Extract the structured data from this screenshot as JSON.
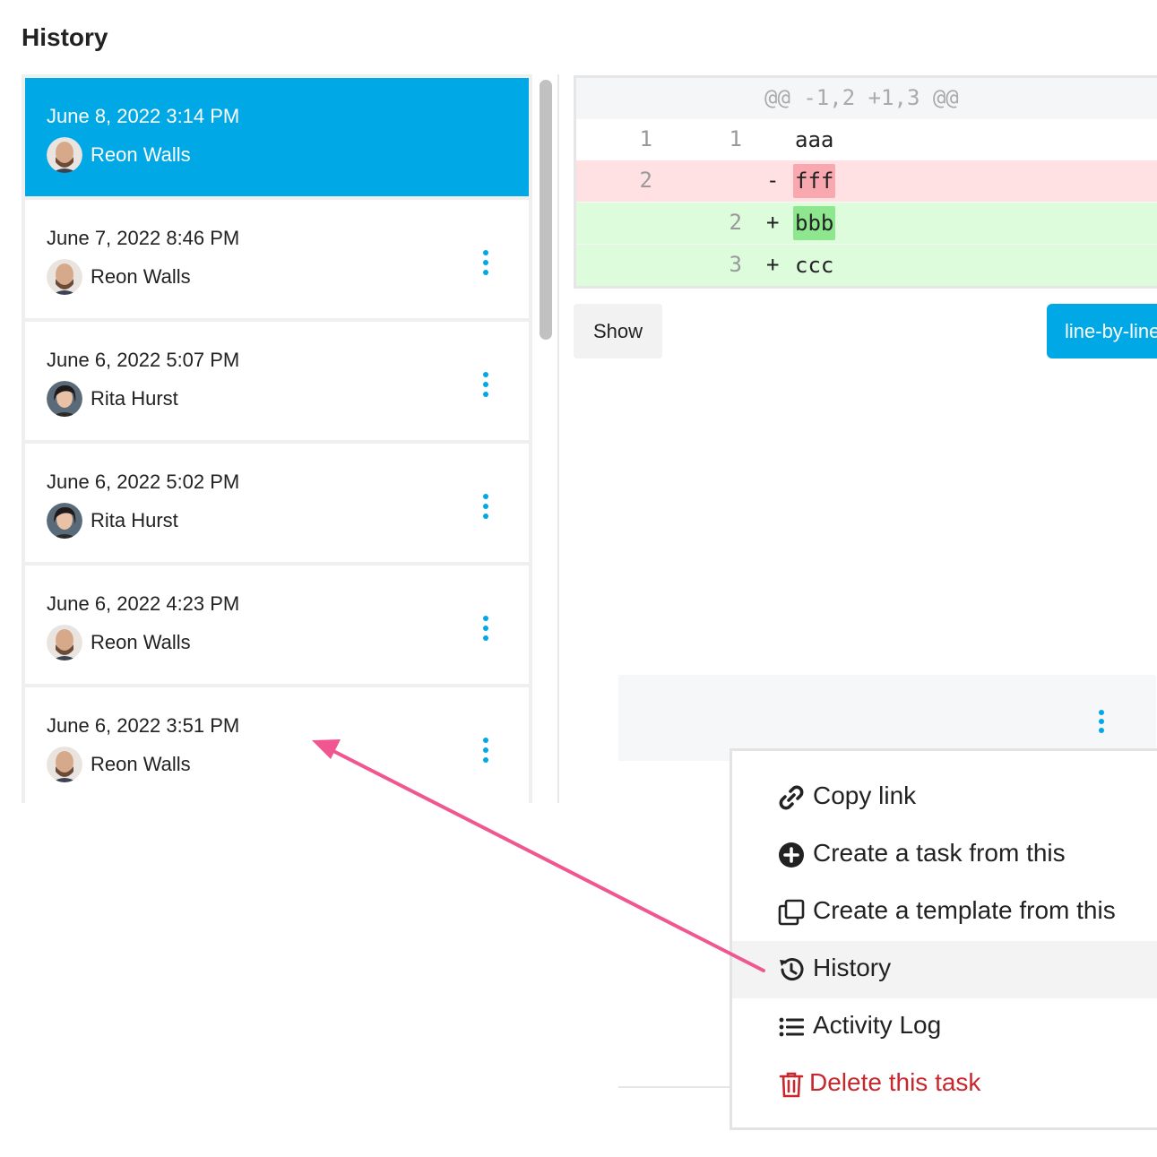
{
  "page_title": "History",
  "history_entries": [
    {
      "date": "June 8, 2022 3:14 PM",
      "user": "Reon Walls",
      "avatar": "man"
    },
    {
      "date": "June 7, 2022 8:46 PM",
      "user": "Reon Walls",
      "avatar": "man"
    },
    {
      "date": "June 6, 2022 5:07 PM",
      "user": "Rita Hurst",
      "avatar": "woman"
    },
    {
      "date": "June 6, 2022 5:02 PM",
      "user": "Rita Hurst",
      "avatar": "woman"
    },
    {
      "date": "June 6, 2022 4:23 PM",
      "user": "Reon Walls",
      "avatar": "man"
    },
    {
      "date": "June 6, 2022 3:51 PM",
      "user": "Reon Walls",
      "avatar": "man"
    }
  ],
  "diff": {
    "hunk_header": "@@ -1,2 +1,3 @@",
    "lines": [
      {
        "old": "1",
        "new": "1",
        "sign": "",
        "text": "aaa",
        "kind": "context"
      },
      {
        "old": "2",
        "new": "",
        "sign": "-",
        "text": "fff",
        "kind": "deleted"
      },
      {
        "old": "",
        "new": "2",
        "sign": "+",
        "text": "bbb",
        "kind": "added"
      },
      {
        "old": "",
        "new": "3",
        "sign": "+",
        "text": "ccc",
        "kind": "added"
      }
    ]
  },
  "buttons": {
    "show": "Show",
    "view_mode": "line-by-line"
  },
  "menu": {
    "items": [
      {
        "label": "Copy link",
        "icon": "link-icon"
      },
      {
        "label": "Create a task from this",
        "icon": "plus-circle-icon"
      },
      {
        "label": "Create a template from this",
        "icon": "copy-icon"
      },
      {
        "label": "History",
        "icon": "history-icon",
        "highlighted": true
      },
      {
        "label": "Activity Log",
        "icon": "list-icon"
      },
      {
        "label": "Delete this task",
        "icon": "trash-icon",
        "danger": true
      }
    ]
  },
  "colors": {
    "accent": "#00a8e6",
    "danger": "#c7282d",
    "annotation_arrow": "#f0568f"
  }
}
